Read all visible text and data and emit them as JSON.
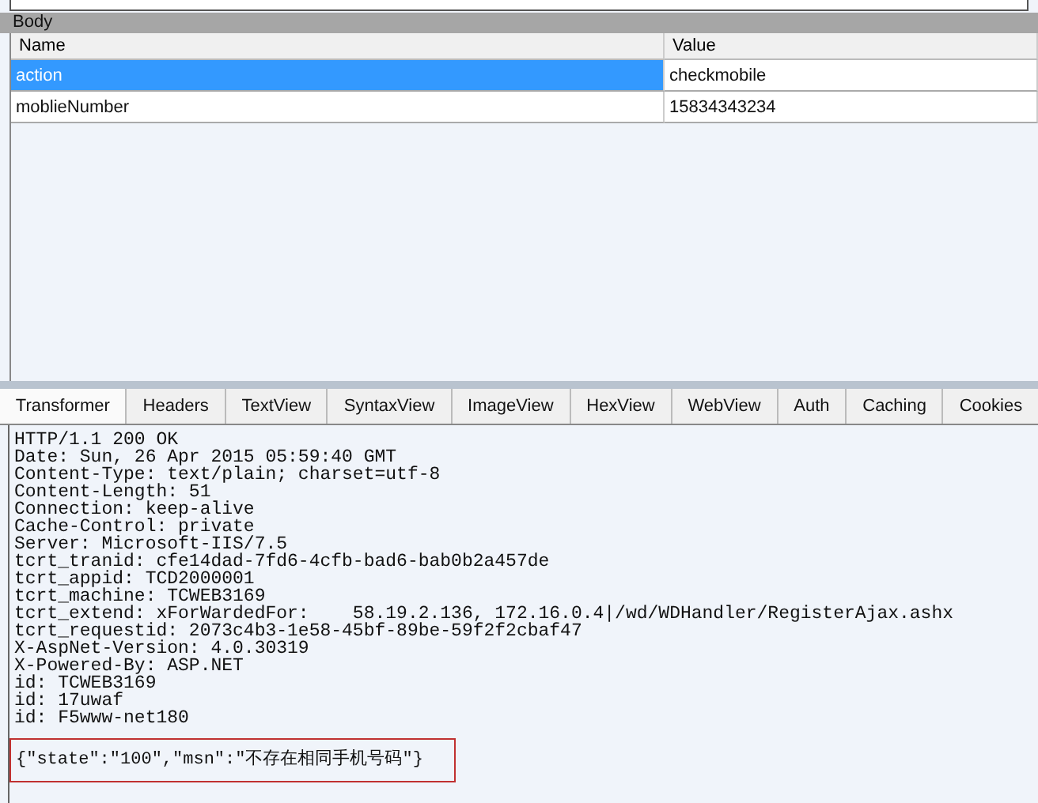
{
  "body_panel": {
    "title": "Body",
    "columns": [
      "Name",
      "Value"
    ],
    "rows": [
      {
        "name": "action",
        "value": "checkmobile",
        "selected": true
      },
      {
        "name": "moblieNumber",
        "value": "15834343234",
        "selected": false
      }
    ]
  },
  "tabs": [
    {
      "label": "Transformer",
      "selected": true
    },
    {
      "label": "Headers",
      "selected": false
    },
    {
      "label": "TextView",
      "selected": false
    },
    {
      "label": "SyntaxView",
      "selected": false
    },
    {
      "label": "ImageView",
      "selected": false
    },
    {
      "label": "HexView",
      "selected": false
    },
    {
      "label": "WebView",
      "selected": false
    },
    {
      "label": "Auth",
      "selected": false
    },
    {
      "label": "Caching",
      "selected": false
    },
    {
      "label": "Cookies",
      "selected": false
    }
  ],
  "response": {
    "header_lines": [
      "HTTP/1.1 200 OK",
      "Date: Sun, 26 Apr 2015 05:59:40 GMT",
      "Content-Type: text/plain; charset=utf-8",
      "Content-Length: 51",
      "Connection: keep-alive",
      "Cache-Control: private",
      "Server: Microsoft-IIS/7.5",
      "tcrt_tranid: cfe14dad-7fd6-4cfb-bad6-bab0b2a457de",
      "tcrt_appid: TCD2000001",
      "tcrt_machine: TCWEB3169",
      "tcrt_extend: xForWardedFor:    58.19.2.136, 172.16.0.4|/wd/WDHandler/RegisterAjax.ashx",
      "tcrt_requestid: 2073c4b3-1e58-45bf-89be-59f2f2cbaf47",
      "X-AspNet-Version: 4.0.30319",
      "X-Powered-By: ASP.NET",
      "id: TCWEB3169",
      "id: 17uwaf",
      "id: F5www-net180"
    ],
    "body": "{\"state\":\"100\",\"msn\":\"不存在相同手机号码\"}"
  }
}
